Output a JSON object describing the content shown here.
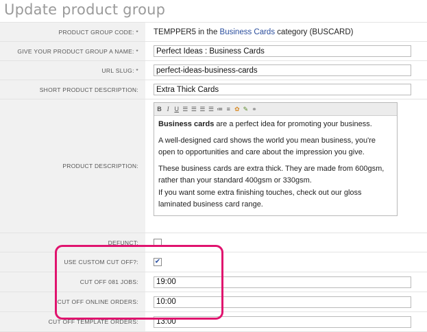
{
  "page": {
    "title": "Update product group"
  },
  "form": {
    "code": {
      "label": "Product group code: *",
      "value": "TEMPPER5",
      "mid_text": "in the",
      "category_link": "Business Cards",
      "suffix": "category (BUSCARD)"
    },
    "name": {
      "label": "Give your product group a name: *",
      "value": "Perfect Ideas : Business Cards"
    },
    "slug": {
      "label": "URL slug: *",
      "value": "perfect-ideas-business-cards"
    },
    "short_desc": {
      "label": "Short product description:",
      "value": "Extra Thick Cards"
    },
    "description": {
      "label": "Product description:",
      "toolbar": [
        "bold-icon",
        "italic-icon",
        "underline-icon",
        "align-left-icon",
        "align-center-icon",
        "align-right-icon",
        "justify-icon",
        "bullet-list-icon",
        "numbered-list-icon",
        "image-icon",
        "media-icon",
        "link-icon"
      ],
      "p1_bold": "Business cards",
      "p1_rest": " are a perfect idea for promoting your business.",
      "p2": "A well-designed card shows the world you mean business, you're open to opportunities and care about the impression you give.",
      "p3_line1": "These business cards are extra thick. They are made from 600gsm, rather than your standard 400gsm or 330gsm.",
      "p3_line2": "If you want some extra finishing touches, check out our gloss laminated business card range."
    },
    "defunct": {
      "label": "Defunct:",
      "checked": false
    },
    "custom_cutoff": {
      "label": "Use custom cut off?:",
      "checked": true
    },
    "cutoff_jobs": {
      "label": "Cut off 081 jobs:",
      "value": "19:00"
    },
    "cutoff_online": {
      "label": "Cut off online orders:",
      "value": "10:00"
    },
    "cutoff_template": {
      "label": "Cut off template orders:",
      "value": "13:00"
    }
  },
  "colors": {
    "highlight": "#e0136e",
    "label_bg": "#f1f1f1",
    "link": "#2a4d9c"
  }
}
